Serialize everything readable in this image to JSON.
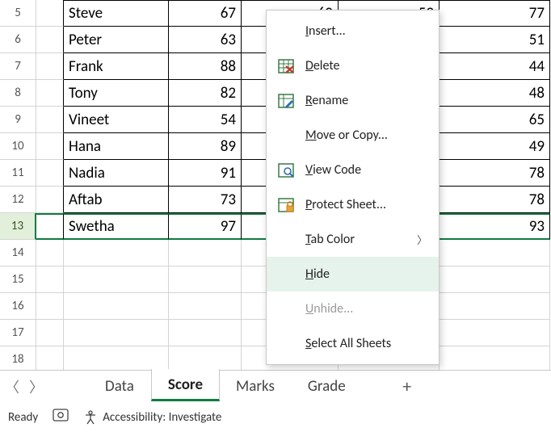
{
  "rows": [
    {
      "n": 5,
      "name": "Steve",
      "c1": 67,
      "c2": "60",
      "c3": "53",
      "c4": 77
    },
    {
      "n": 6,
      "name": "Peter",
      "c1": 63,
      "c4": 51
    },
    {
      "n": 7,
      "name": "Frank",
      "c1": 88,
      "c4": 44
    },
    {
      "n": 8,
      "name": "Tony",
      "c1": 82,
      "c4": 48
    },
    {
      "n": 9,
      "name": "Vineet",
      "c1": 54,
      "c4": 65
    },
    {
      "n": 10,
      "name": "Hana",
      "c1": 89,
      "c4": 49
    },
    {
      "n": 11,
      "name": "Nadia",
      "c1": 91,
      "c4": 78
    },
    {
      "n": 12,
      "name": "Aftab",
      "c1": 73,
      "c4": 78
    },
    {
      "n": 13,
      "name": "Swetha",
      "c1": 97,
      "c4": 93,
      "selected": true
    },
    {
      "n": 14
    },
    {
      "n": 15
    },
    {
      "n": 16
    },
    {
      "n": 17
    },
    {
      "n": 18
    }
  ],
  "menu": {
    "insert": "Insert...",
    "delete": "Delete",
    "rename": "Rename",
    "move": "Move or Copy...",
    "view": "View Code",
    "protect": "Protect Sheet...",
    "tabcolor": "Tab Color",
    "hide": "Hide",
    "unhide": "Unhide...",
    "selectall": "Select All Sheets"
  },
  "tabs": {
    "t1": "Data",
    "t2": "Score",
    "t3": "Marks",
    "t4": "Grade",
    "active": "Score"
  },
  "status": {
    "ready": "Ready",
    "acc": "Accessibility: Investigate"
  }
}
